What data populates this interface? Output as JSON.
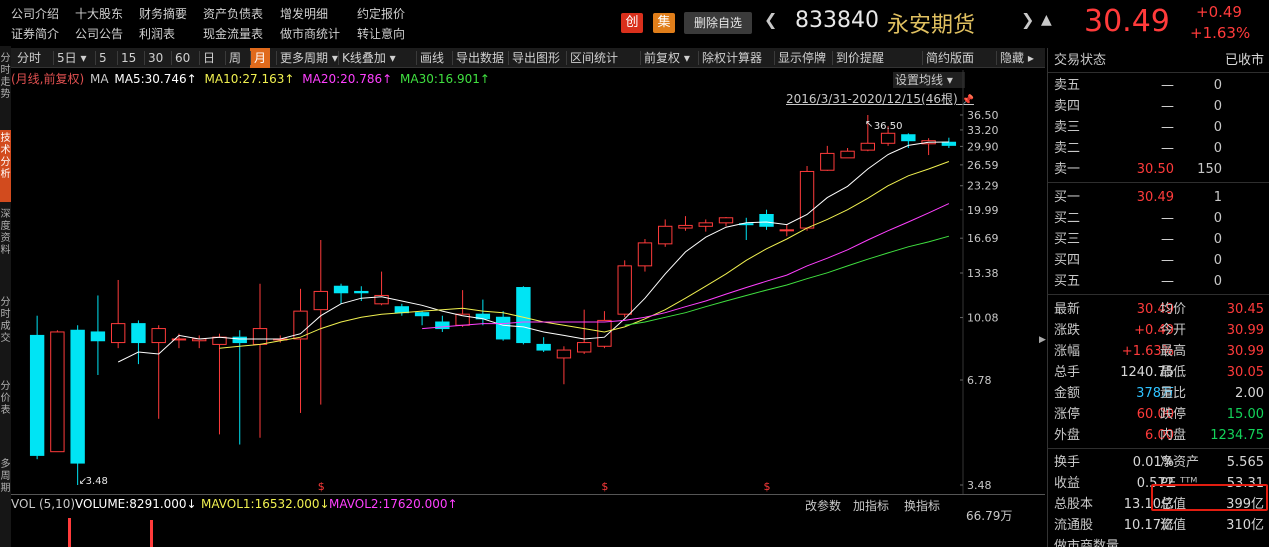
{
  "top_links": {
    "row1": [
      "公司介绍",
      "十大股东",
      "财务摘要",
      "资产负债表",
      "增发明细",
      "约定报价"
    ],
    "row2": [
      "证券简介",
      "公司公告",
      "利润表",
      "现金流量表",
      "做市商统计",
      "转让意向"
    ]
  },
  "header": {
    "badge_chuang": "创",
    "badge_ji": "集",
    "remove_btn": "删除自选",
    "arrow_left": "❮",
    "code": "833840",
    "name": "永安期货",
    "arrow_right": "❯",
    "price": "30.49",
    "change": "+0.49",
    "pct": "+1.63%"
  },
  "left_tabs": [
    {
      "label": "分时走势",
      "active": false
    },
    {
      "label": "技术分析",
      "active": true
    },
    {
      "label": "深度资料",
      "active": false
    },
    {
      "label": "分时成交",
      "active": false
    },
    {
      "label": "分价表",
      "active": false
    },
    {
      "label": "多周期",
      "active": false
    }
  ],
  "toolbar": {
    "items": [
      "分时",
      "5日 ▾",
      "5",
      "15",
      "30",
      "60",
      "日",
      "周",
      "月",
      "更多周期 ▾",
      "K线叠加 ▾",
      "画线",
      "导出数据",
      "导出图形",
      "区间统计",
      "前复权 ▾",
      "除权计算器",
      "显示停牌",
      "到价提醒",
      "简约版面",
      "隐藏 ▸"
    ],
    "active_index": 8
  },
  "ma": {
    "mode": "(月线,前复权)",
    "ma_label": "MA",
    "ma5": "MA5:30.746↑",
    "ma10": "MA10:27.163↑",
    "ma20": "MA20:20.786↑",
    "ma30": "MA30:16.901↑",
    "colors": {
      "ma5": "#ffffff",
      "ma10": "#f0f050",
      "ma20": "#ff40ff",
      "ma30": "#40e040"
    }
  },
  "set_ma": "设置均线 ▾",
  "range": "2016/3/31-2020/12/15(46根)",
  "pin": "📌",
  "chart_data": {
    "type": "candlestick",
    "y_scale": "log",
    "y_ticks": [
      "36.50",
      "33.20",
      "29.90",
      "26.59",
      "23.29",
      "19.99",
      "16.69",
      "13.38",
      "10.08",
      "6.78",
      "3.48"
    ],
    "max_label": "36.50",
    "min_label": "3.48",
    "dividend_marks": [
      "$",
      "$",
      "$"
    ],
    "candles": [
      [
        9.0,
        4.2,
        10.2,
        4.1
      ],
      [
        4.3,
        9.2,
        9.3,
        4.3
      ],
      [
        9.3,
        4.0,
        9.6,
        3.48
      ],
      [
        9.2,
        8.7,
        11.6,
        7.0
      ],
      [
        8.6,
        9.7,
        12.8,
        8.3
      ],
      [
        9.7,
        8.6,
        9.9,
        7.5
      ],
      [
        8.6,
        9.4,
        9.6,
        5.3
      ],
      [
        8.8,
        8.8,
        9.1,
        8.3
      ],
      [
        8.7,
        8.8,
        9.0,
        8.3
      ],
      [
        8.5,
        8.9,
        9.1,
        4.8
      ],
      [
        8.9,
        8.6,
        9.3,
        4.5
      ],
      [
        8.5,
        9.4,
        12.5,
        4.7
      ],
      [
        8.8,
        8.8,
        9.0,
        8.6
      ],
      [
        8.8,
        10.5,
        12.1,
        5.5
      ],
      [
        10.6,
        11.9,
        16.5,
        5.8
      ],
      [
        12.3,
        11.8,
        12.5,
        11.0
      ],
      [
        11.9,
        11.8,
        12.3,
        11.2
      ],
      [
        11.0,
        11.6,
        13.5,
        10.9
      ],
      [
        10.8,
        10.4,
        11.0,
        10.2
      ],
      [
        10.4,
        10.2,
        10.5,
        9.6
      ],
      [
        9.8,
        9.4,
        10.2,
        9.2
      ],
      [
        9.6,
        10.3,
        12.0,
        9.5
      ],
      [
        10.3,
        10.0,
        11.3,
        9.6
      ],
      [
        10.1,
        8.8,
        10.5,
        8.7
      ],
      [
        12.2,
        8.6,
        12.3,
        8.5
      ],
      [
        8.5,
        8.2,
        8.9,
        8.1
      ],
      [
        7.8,
        8.2,
        8.4,
        6.6
      ],
      [
        8.1,
        8.6,
        10.6,
        8.0
      ],
      [
        8.4,
        9.9,
        10.5,
        8.3
      ],
      [
        10.3,
        14.0,
        14.5,
        10.1
      ],
      [
        14.0,
        16.2,
        16.6,
        13.5
      ],
      [
        16.1,
        18.0,
        18.8,
        15.8
      ],
      [
        17.8,
        18.1,
        19.2,
        17.5
      ],
      [
        18.0,
        18.4,
        18.8,
        17.4
      ],
      [
        18.4,
        19.0,
        19.1,
        18.0
      ],
      [
        18.3,
        18.2,
        19.0,
        16.5
      ],
      [
        19.4,
        18.0,
        20.0,
        17.6
      ],
      [
        17.5,
        17.6,
        18.2,
        16.9
      ],
      [
        17.8,
        25.5,
        26.4,
        17.5
      ],
      [
        25.7,
        28.6,
        30.0,
        25.6
      ],
      [
        27.8,
        29.0,
        29.6,
        27.8
      ],
      [
        29.2,
        30.5,
        36.5,
        29.0
      ],
      [
        30.5,
        32.5,
        34.0,
        30.0
      ],
      [
        32.2,
        31.0,
        32.5,
        29.6
      ],
      [
        30.4,
        31.0,
        31.5,
        28.3
      ],
      [
        30.7,
        30.1,
        31.6,
        29.6
      ]
    ],
    "ma5": [
      null,
      null,
      null,
      null,
      7.6,
      8.1,
      8.0,
      9.0,
      8.8,
      8.9,
      8.8,
      8.8,
      8.8,
      9.1,
      10.2,
      11.0,
      11.4,
      11.5,
      11.2,
      10.9,
      10.5,
      10.2,
      10.0,
      9.6,
      9.5,
      9.2,
      9.0,
      8.8,
      8.9,
      10.0,
      11.4,
      13.3,
      15.3,
      16.8,
      17.9,
      18.4,
      18.5,
      18.2,
      19.4,
      21.6,
      23.2,
      25.9,
      28.4,
      30.1,
      30.7,
      30.75
    ],
    "ma10": [
      null,
      null,
      null,
      null,
      null,
      null,
      null,
      null,
      null,
      8.3,
      8.4,
      8.5,
      8.7,
      8.9,
      9.4,
      9.8,
      10.1,
      10.3,
      10.4,
      10.5,
      10.6,
      10.7,
      10.5,
      10.4,
      10.1,
      9.8,
      9.6,
      9.4,
      9.2,
      9.5,
      10.0,
      10.6,
      11.4,
      12.3,
      13.3,
      14.5,
      15.6,
      16.6,
      17.8,
      18.8,
      20.0,
      21.5,
      23.3,
      24.8,
      25.9,
      27.16
    ],
    "ma20": [
      null,
      null,
      null,
      null,
      null,
      null,
      null,
      null,
      null,
      null,
      null,
      null,
      null,
      null,
      null,
      null,
      null,
      null,
      null,
      9.4,
      9.5,
      9.6,
      9.7,
      9.7,
      9.8,
      9.8,
      9.8,
      9.8,
      9.8,
      9.9,
      10.1,
      10.4,
      10.8,
      11.2,
      11.7,
      12.2,
      12.7,
      13.2,
      14.0,
      14.7,
      15.5,
      16.5,
      17.5,
      18.5,
      19.6,
      20.79
    ],
    "ma30": [
      null,
      null,
      null,
      null,
      null,
      null,
      null,
      null,
      null,
      null,
      null,
      null,
      null,
      null,
      null,
      null,
      null,
      null,
      null,
      null,
      null,
      null,
      null,
      null,
      null,
      null,
      null,
      null,
      null,
      9.6,
      9.8,
      10.1,
      10.4,
      10.8,
      11.2,
      11.6,
      12.0,
      12.4,
      12.9,
      13.4,
      14.0,
      14.6,
      15.2,
      15.8,
      16.3,
      16.9
    ]
  },
  "volume": {
    "label": "VOL (5,10)",
    "volume": "VOLUME:8291.000↓",
    "mavol1": "MAVOL1:16532.000↓",
    "mavol2": "MAVOL2:17620.000↑",
    "btn_params": "改参数",
    "btn_add": "加指标",
    "btn_switch": "换指标",
    "axis_label": "66.79万"
  },
  "right_panel": {
    "status_label": "交易状态",
    "status_value": "已收市",
    "sells": [
      {
        "label": "卖五",
        "price": "—",
        "vol": "0"
      },
      {
        "label": "卖四",
        "price": "—",
        "vol": "0"
      },
      {
        "label": "卖三",
        "price": "—",
        "vol": "0"
      },
      {
        "label": "卖二",
        "price": "—",
        "vol": "0"
      },
      {
        "label": "卖一",
        "price": "30.50",
        "vol": "150"
      }
    ],
    "buys": [
      {
        "label": "买一",
        "price": "30.49",
        "vol": "1"
      },
      {
        "label": "买二",
        "price": "—",
        "vol": "0"
      },
      {
        "label": "买三",
        "price": "—",
        "vol": "0"
      },
      {
        "label": "买四",
        "price": "—",
        "vol": "0"
      },
      {
        "label": "买五",
        "price": "—",
        "vol": "0"
      }
    ],
    "stats1": [
      {
        "l1": "最新",
        "v1": "30.49",
        "c1": "red",
        "l2": "均价",
        "v2": "30.45",
        "c2": "red"
      },
      {
        "l1": "涨跌",
        "v1": "+0.49",
        "c1": "red",
        "l2": "今开",
        "v2": "30.99",
        "c2": "red"
      },
      {
        "l1": "涨幅",
        "v1": "+1.63%",
        "c1": "red",
        "l2": "最高",
        "v2": "30.99",
        "c2": "red"
      },
      {
        "l1": "总手",
        "v1": "1240.75",
        "c1": "white",
        "l2": "最低",
        "v2": "30.05",
        "c2": "red"
      },
      {
        "l1": "金额",
        "v1": "378万",
        "c1": "cyan",
        "l2": "量比",
        "v2": "2.00",
        "c2": "white"
      },
      {
        "l1": "涨停",
        "v1": "60.00",
        "c1": "red",
        "l2": "跌停",
        "v2": "15.00",
        "c2": "green"
      },
      {
        "l1": "外盘",
        "v1": "6.00",
        "c1": "red",
        "l2": "内盘",
        "v2": "1234.75",
        "c2": "green"
      }
    ],
    "stats2": [
      {
        "l1": "换手",
        "v1": "0.01%",
        "c1": "white",
        "l2": "净资产",
        "v2": "5.565",
        "c2": "white"
      },
      {
        "l1": "收益",
        "v1": "0.572",
        "c1": "white",
        "l2": "PE ᵀᵀᴹ",
        "v2": "53.31",
        "c2": "white"
      },
      {
        "l1": "总股本",
        "v1": "13.10亿",
        "c1": "white",
        "l2": "总值",
        "v2": "399亿",
        "c2": "white"
      },
      {
        "l1": "流通股",
        "v1": "10.17亿",
        "c1": "white",
        "l2": "流值",
        "v2": "310亿",
        "c2": "white"
      },
      {
        "l1": "做市商数量",
        "v1": "",
        "c1": "white",
        "l2": "",
        "v2": "",
        "c2": "white"
      }
    ],
    "sidebar_arrow": "▶"
  },
  "colors": {
    "up": "#ff3b3b",
    "down": "#00e4f4",
    "accent": "#e06a1c",
    "highlight": "#e21d10"
  }
}
